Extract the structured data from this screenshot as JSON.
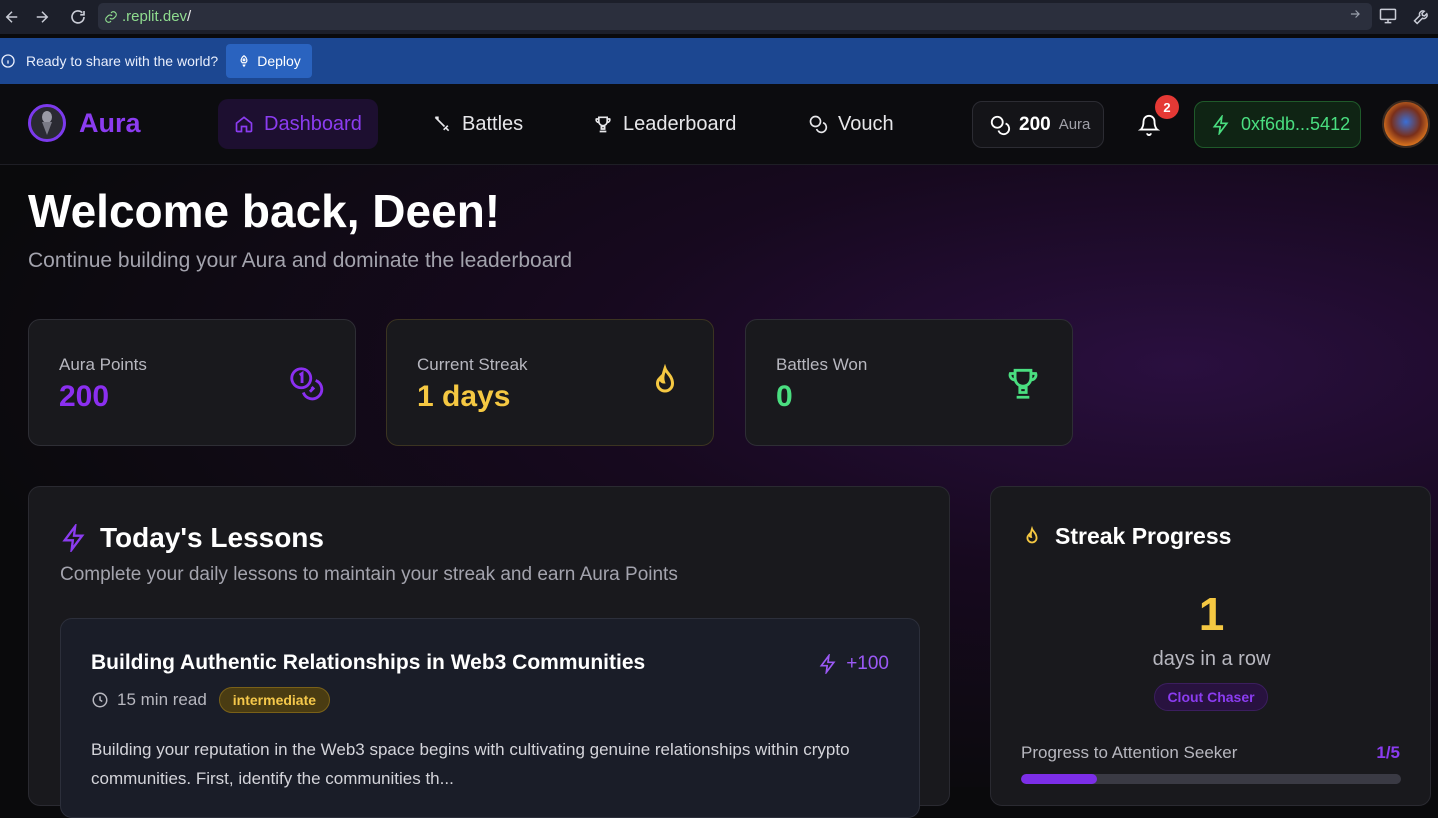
{
  "browser": {
    "url_domain": ".replit.dev",
    "url_path": "/"
  },
  "deploy_banner": {
    "message": "Ready to share with the world?",
    "button_label": "Deploy"
  },
  "nav": {
    "logo_text": "Aura",
    "items": [
      {
        "label": "Dashboard",
        "icon": "home-icon",
        "active": true
      },
      {
        "label": "Battles",
        "icon": "swords-icon",
        "active": false
      },
      {
        "label": "Leaderboard",
        "icon": "trophy-icon",
        "active": false
      },
      {
        "label": "Vouch",
        "icon": "coins-icon",
        "active": false
      }
    ],
    "aura_balance": "200",
    "aura_unit": "Aura",
    "notification_count": "2",
    "wallet_address": "0xf6db...5412"
  },
  "header": {
    "title": "Welcome back, Deen!",
    "subtitle": "Continue building your Aura and dominate the leaderboard"
  },
  "stats": [
    {
      "label": "Aura Points",
      "value": "200",
      "color": "#8b2ff0",
      "icon": "coins-icon"
    },
    {
      "label": "Current Streak",
      "value": "1 days",
      "color": "#f5c842",
      "icon": "flame-icon"
    },
    {
      "label": "Battles Won",
      "value": "0",
      "color": "#4ade80",
      "icon": "trophy-icon"
    }
  ],
  "lessons": {
    "title": "Today's Lessons",
    "description": "Complete your daily lessons to maintain your streak and earn Aura Points",
    "items": [
      {
        "title": "Building Authentic Relationships in Web3 Communities",
        "reward": "+100",
        "read_time": "15 min read",
        "level": "intermediate",
        "excerpt": "Building your reputation in the Web3 space begins with cultivating genuine relationships within crypto communities. First, identify the communities th..."
      }
    ]
  },
  "streak": {
    "title": "Streak Progress",
    "count": "1",
    "unit": "days in a row",
    "rank": "Clout Chaser",
    "progress_label": "Progress to Attention Seeker",
    "progress_count": "1/5",
    "progress_fraction": 0.2
  },
  "colors": {
    "accent_purple": "#8b3cf0",
    "accent_yellow": "#f5c842",
    "accent_green": "#4ade80",
    "banner_blue": "#1c4791"
  }
}
